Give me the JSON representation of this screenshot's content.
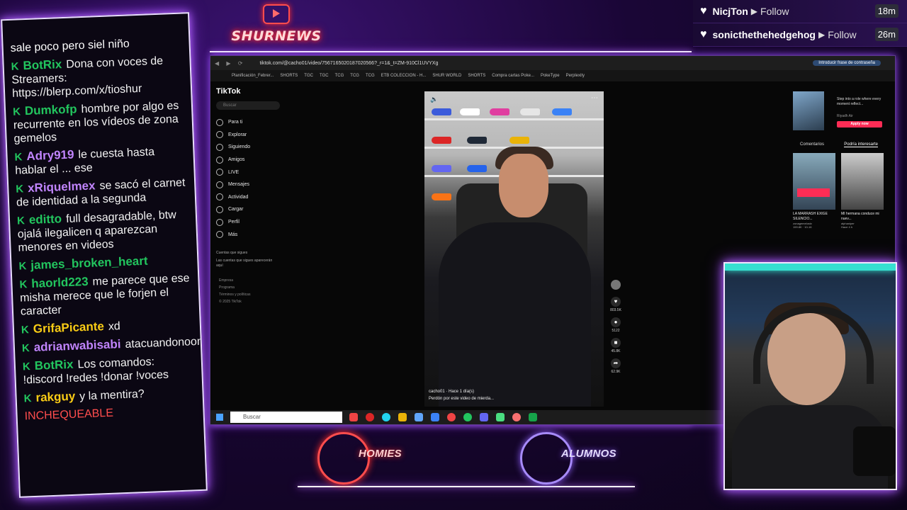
{
  "brand": {
    "title": "SHURNEWS"
  },
  "alerts": [
    {
      "name": "NicjTon",
      "action": "Follow",
      "time": "18m"
    },
    {
      "name": "sonicthethehedgehog",
      "action": "Follow",
      "time": "26m"
    }
  ],
  "chat": [
    {
      "user": "",
      "user_color": "#ffffff",
      "text": "sale poco                pero siel niño"
    },
    {
      "user": "BotRix",
      "user_color": "#22c55e",
      "text": "Dona con voces de Streamers: https://blerp.com/x/tioshur"
    },
    {
      "user": "Dumkofp",
      "user_color": "#22c55e",
      "text": "hombre por algo es recurrente en los vídeos de zona gemelos"
    },
    {
      "user": "Adry919",
      "user_color": "#c084fc",
      "text": "le cuesta hasta hablar el ... ese"
    },
    {
      "user": "xRiquelmex",
      "user_color": "#c084fc",
      "text": "se sacó el carnet de identidad a la segunda"
    },
    {
      "user": "editto",
      "user_color": "#22c55e",
      "text": "full desagradable, btw ojalá ilegalicen q aparezcan menores en videos"
    },
    {
      "user": "james_broken_heart",
      "user_color": "#22c55e",
      "text": ""
    },
    {
      "user": "haorld223",
      "user_color": "#22c55e",
      "text": "me parece que ese misha merece que le forjen el caracter"
    },
    {
      "user": "GrifaPicante",
      "user_color": "#facc15",
      "text": "xd"
    },
    {
      "user": "adrianwabisabi",
      "user_color": "#c084fc",
      "text": "atacuandonoono"
    },
    {
      "user": "BotRix",
      "user_color": "#22c55e",
      "text": "Los comandos: !discord !redes !donar !voces"
    },
    {
      "user": "rakguy",
      "user_color": "#facc15",
      "text": "y la mentira?"
    },
    {
      "user": "",
      "user_color": "#ff4d4d",
      "text": "INCHEQUEABLE"
    }
  ],
  "browser": {
    "url": "tiktok.com/@cacho01/video/7567165020187020566?_r=1&_t=ZM-910Cl1UVYXg",
    "password_prompt": "Introducir frase de contraseña",
    "bookmarks": [
      "Planificación_Febrer...",
      "SHORTS",
      "TGC",
      "TGC",
      "TCG",
      "TCG",
      "TCG",
      "ETB COLECCION - H...",
      "SHUR WORLD",
      "SHORTS",
      "Compra cartas Poke...",
      "PokeType",
      "Perplexity"
    ]
  },
  "tiktok": {
    "logo": "TikTok",
    "search_placeholder": "Buscar",
    "nav": [
      "Para ti",
      "Explorar",
      "Siguiendo",
      "Amigos",
      "LIVE",
      "Mensajes",
      "Actividad",
      "Cargar",
      "Perfil",
      "Más"
    ],
    "following_title": "Cuentas que sigues",
    "following_sub": "Las cuentas que sigues aparecerán aquí",
    "footer": [
      "Empresa",
      "Programa",
      "Términos y políticas",
      "© 2025 TikTok"
    ],
    "video_author": "cacho01 · Hace 1 día(s)",
    "video_caption": "Perdón por este video de mierda...",
    "actions": [
      {
        "icon": "♥",
        "count": "803.5K"
      },
      {
        "icon": "●",
        "count": "5122"
      },
      {
        "icon": "■",
        "count": "45.8K"
      },
      {
        "icon": "➦",
        "count": "62.9K"
      }
    ],
    "ad_text": "Step into a role where every moment reflect...",
    "ad_sub": "Riyadh Air",
    "ad_button": "Apply now",
    "tab_comments": "Comentarios",
    "tab_interest": "Podría interesarte",
    "thumbs": [
      {
        "caption": "LA MARRASH EXIGE SILENCIO...",
        "author": "zonagemelostv",
        "meta": "159.8K · 10-16"
      },
      {
        "caption": "MI hermana conduce mi nuev...",
        "author": "alphaniper",
        "meta": "Hace 4 h"
      }
    ]
  },
  "taskbar": {
    "search": "Buscar"
  },
  "bottom_logos": [
    {
      "label": "HOMIES",
      "color": "#ff4d4d"
    },
    {
      "label": "ALUMNOS",
      "color": "#a78bfa"
    }
  ]
}
